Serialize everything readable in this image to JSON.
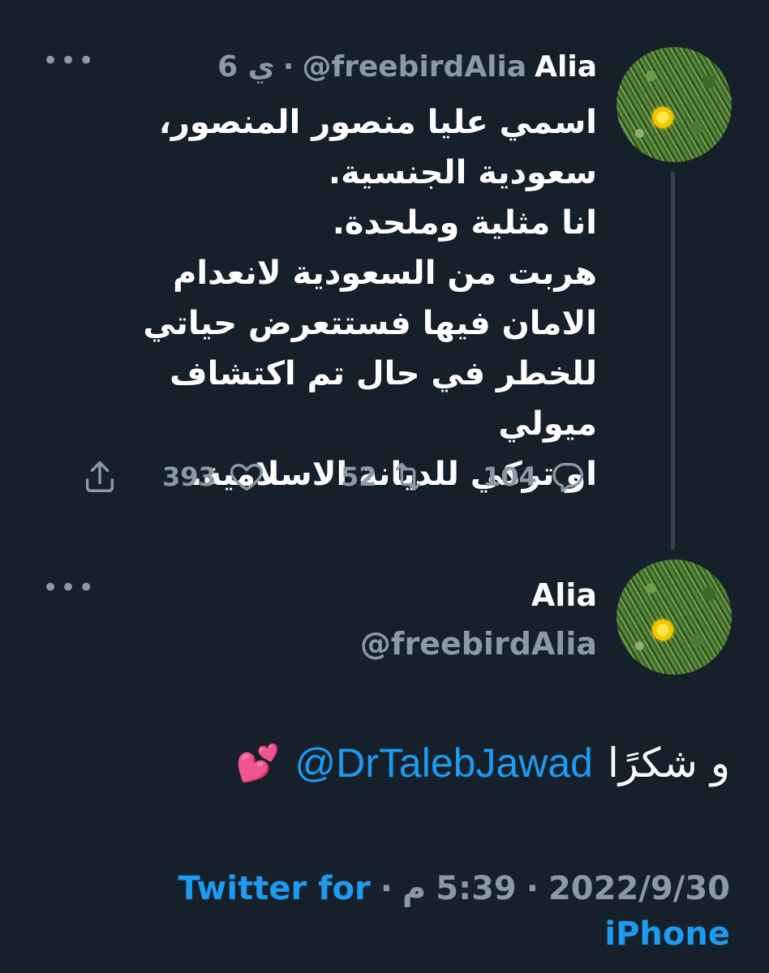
{
  "tweet1": {
    "name": "Alia",
    "handle": "@freebirdAlia",
    "separator": "·",
    "time": "6 ي",
    "more_icon": "more-horizontal-icon",
    "text": "اسمي عليا منصور المنصور،\nسعودية الجنسية.\nانا مثلية وملحدة.\nهربت من السعودية لانعدام\nالامان فيها فستتعرض حياتي\nللخطر في حال تم اكتشاف ميولي\nاو تركي للديانة الاسلامية.",
    "actions": {
      "reply_count": "104",
      "retweet_count": "52",
      "like_count": "393"
    }
  },
  "tweet2": {
    "name": "Alia",
    "handle": "@freebirdAlia",
    "more_icon": "more-horizontal-icon",
    "text_prefix": "و شكرًا",
    "mention": "@DrTalebJawad",
    "emoji": "💕",
    "date": "2022/9/30",
    "time": "5:39",
    "ampm": "م",
    "separator": "·",
    "source_line1": "Twitter for",
    "source_line2": "iPhone"
  },
  "colors": {
    "background": "#15202b",
    "secondary_text": "#8b98a5",
    "link": "#1d9bf0",
    "thread_line": "#38444d"
  }
}
